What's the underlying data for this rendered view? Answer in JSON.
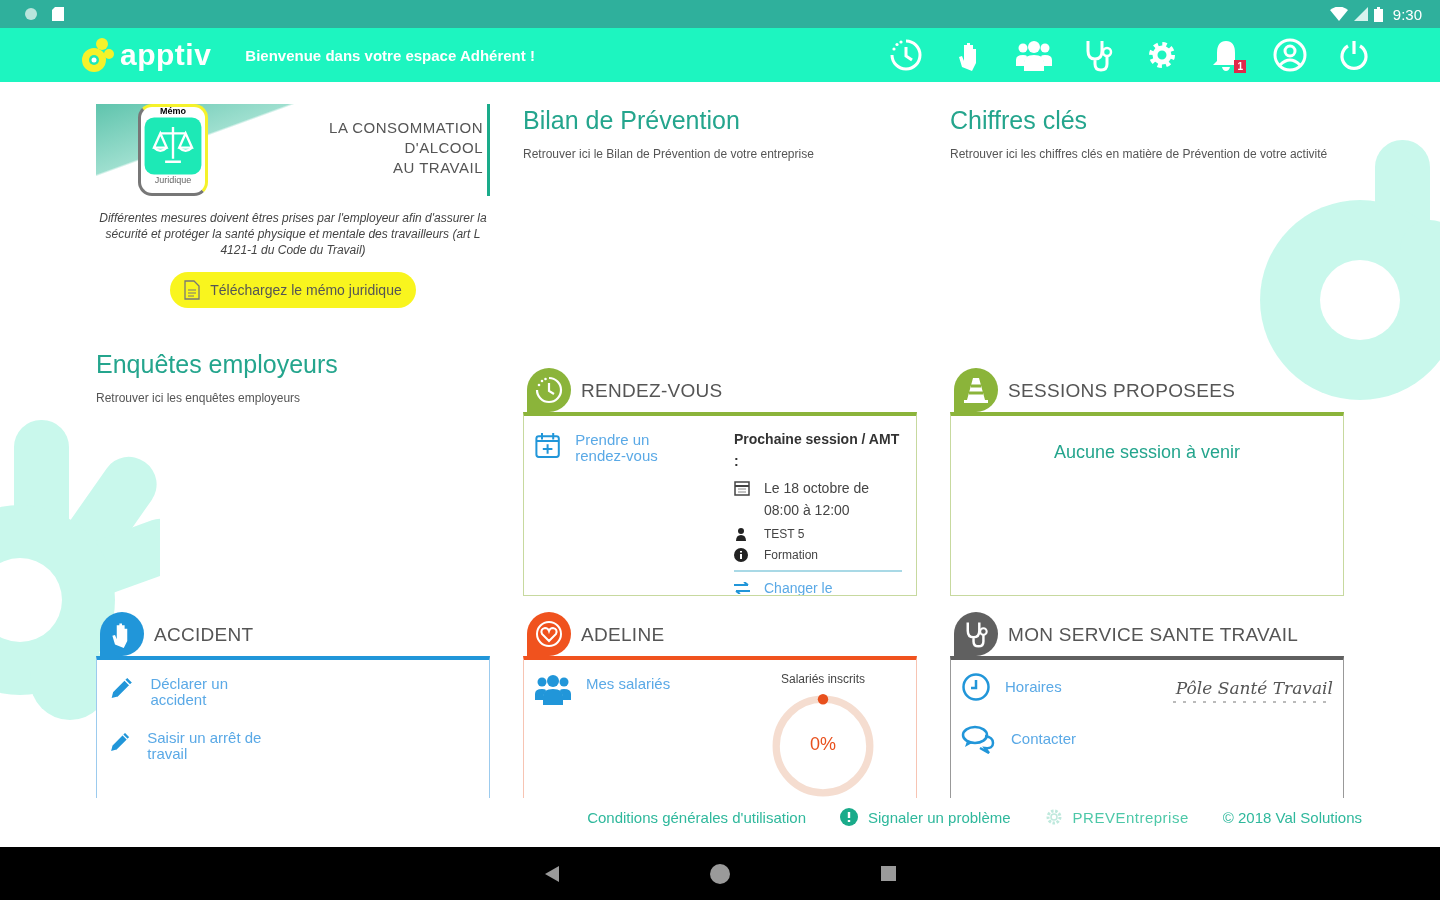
{
  "status_bar": {
    "time": "9:30"
  },
  "app_bar": {
    "logo": "apptiv",
    "welcome": "Bienvenue dans votre espace Adhérent !",
    "notification_count": "1"
  },
  "memo": {
    "tag": "Mémo",
    "subtag": "Juridique",
    "title_lines": [
      "LA CONSOMMATION",
      "D'ALCOOL",
      "AU TRAVAIL"
    ],
    "description": "Différentes mesures doivent êtres prises par l'employeur afin d'assurer la sécurité et protéger la santé physique et mentale des travailleurs (art L 4121-1 du Code du Travail)",
    "button": "Téléchargez le mémo juridique"
  },
  "sections": [
    {
      "title": "Bilan de Prévention",
      "text": "Retrouver ici le Bilan de Prévention de votre entreprise"
    },
    {
      "title": "Chiffres clés",
      "text": "Retrouver ici les chiffres clés en matière de Prévention de votre activité"
    },
    {
      "title": "Enquêtes employeurs",
      "text": "Retrouver ici les enquêtes employeurs"
    }
  ],
  "cards": [
    {
      "kind": "rendezvous",
      "title": "RENDEZ-VOUS",
      "color": "#8bb43a",
      "link": "Prendre un rendez-vous",
      "next_title": "Prochaine session / AMT :",
      "date": "Le 18 octobre de 08:00 à 12:00",
      "person": "TEST 5",
      "type": "Formation",
      "change_link": "Changer le"
    },
    {
      "kind": "sessions",
      "title": "SESSIONS PROPOSEES",
      "color": "#8bb43a",
      "empty": "Aucune session à venir"
    },
    {
      "kind": "accident",
      "title": "ACCIDENT",
      "color": "#2196d9",
      "links": [
        "Déclarer un accident",
        "Saisir un arrêt de travail"
      ]
    },
    {
      "kind": "adeline",
      "title": "ADELINE",
      "color": "#f0521e",
      "link": "Mes salariés",
      "gauge_label": "Salariés inscrits",
      "gauge_value": "0%"
    },
    {
      "kind": "service",
      "title": "MON SERVICE SANTE TRAVAIL",
      "color": "#606060",
      "links": [
        "Horaires",
        "Contacter"
      ],
      "logo_text": "Pôle Santé Travail"
    }
  ],
  "footer": {
    "terms": "Conditions générales d'utilisation",
    "report": "Signaler un problème",
    "brand": "PREVEntreprise",
    "copyright": "© 2018 Val Solutions"
  }
}
